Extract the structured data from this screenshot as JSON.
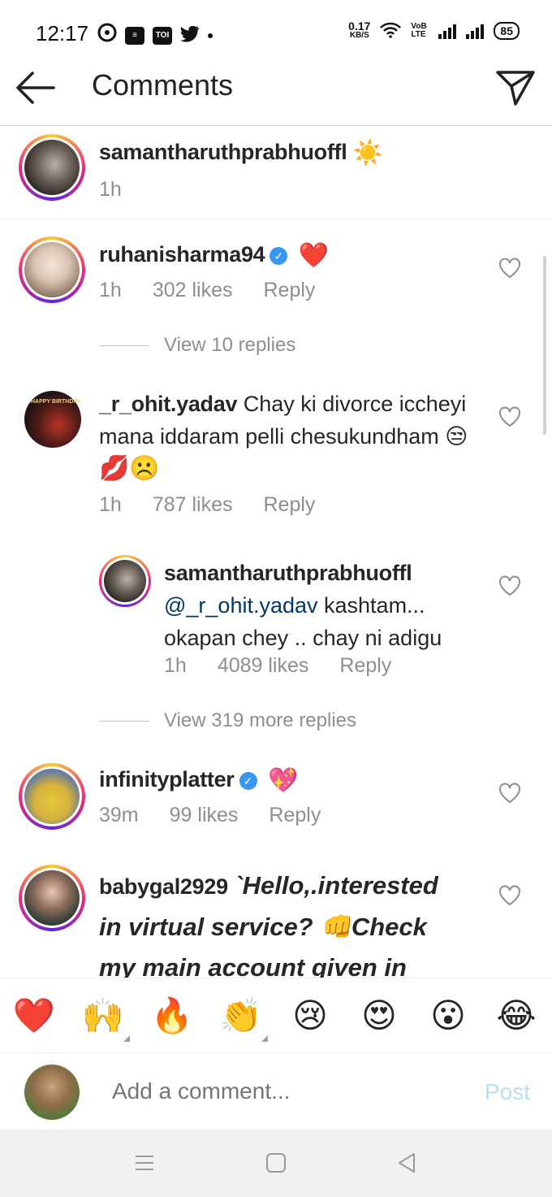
{
  "status_bar": {
    "time": "12:17",
    "speed_value": "0.17",
    "speed_unit": "KB/S",
    "network_label": "VoB LTE",
    "battery": "85",
    "notif_icons": [
      "settings-icon",
      "document-icon",
      "toi-icon",
      "twitter-icon"
    ],
    "toi_label": "TOI"
  },
  "header": {
    "title": "Comments",
    "back_icon": "arrow-left-icon",
    "send_icon": "paper-plane-icon"
  },
  "caption": {
    "username": "samantharuthprabhuoffl",
    "emoji": "☀️",
    "time": "1h"
  },
  "comments": [
    {
      "username": "ruhanisharma94",
      "verified": true,
      "text": "❤️",
      "time": "1h",
      "likes": "302 likes",
      "reply": "Reply",
      "view_replies": "View 10 replies"
    },
    {
      "username": "_r_ohit.yadav",
      "text_line1": "Chay ki divorce iccheyi",
      "text_line2": "mana iddaram pelli chesukundham 😒",
      "text_line3": "💋☹️",
      "time": "1h",
      "likes": "787 likes",
      "reply": "Reply",
      "avatar_text": "HAPPY BIRTHDAY"
    },
    {
      "username": "samantharuthprabhuoffl",
      "mention": "@_r_ohit.yadav",
      "text_line1": " kashtam...",
      "text_line2": "okapan chey .. chay ni adigu",
      "time": "1h",
      "likes": "4089 likes",
      "reply": "Reply",
      "view_replies": "View 319 more replies"
    },
    {
      "username": "infinityplatter",
      "verified": true,
      "text": "💖",
      "time": "39m",
      "likes": "99 likes",
      "reply": "Reply"
    },
    {
      "username": "babygal2929",
      "text_line1": "`Hello,.interested",
      "text_line2": "in virtual service? 👊Check",
      "text_line3": "my main account given in"
    }
  ],
  "emoji_bar": [
    "❤️",
    "🙌",
    "🔥",
    "👏",
    "😢",
    "😍",
    "😮",
    "😂"
  ],
  "comment_bar": {
    "placeholder": "Add a comment...",
    "post": "Post"
  },
  "nav": [
    "menu-icon",
    "home-square-icon",
    "back-triangle-icon"
  ],
  "colors": {
    "meta_gray": "#8e8e8e",
    "verified_blue": "#3897f0",
    "post_blue_disabled": "#b2dffc",
    "mention": "#00376b"
  }
}
